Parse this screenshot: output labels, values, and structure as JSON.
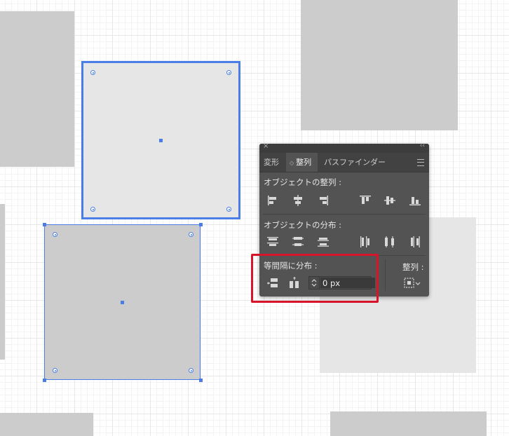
{
  "panel": {
    "tabs": [
      {
        "label": "変形"
      },
      {
        "label": "整列"
      },
      {
        "label": "パスファインダー"
      }
    ],
    "sections": {
      "align_objects": "オブジェクトの整列 :",
      "distribute_objects": "オブジェクトの分布 :",
      "distribute_spacing": "等間隔に分布 :",
      "align_to": "整列 :"
    },
    "spacing": {
      "value": "0 px"
    }
  },
  "colors": {
    "selection": "#4a7ee6",
    "highlight": "#d7142a",
    "panel_bg": "#535353",
    "shape_gray": "#cccccc",
    "shape_light": "#e6e6e6"
  }
}
